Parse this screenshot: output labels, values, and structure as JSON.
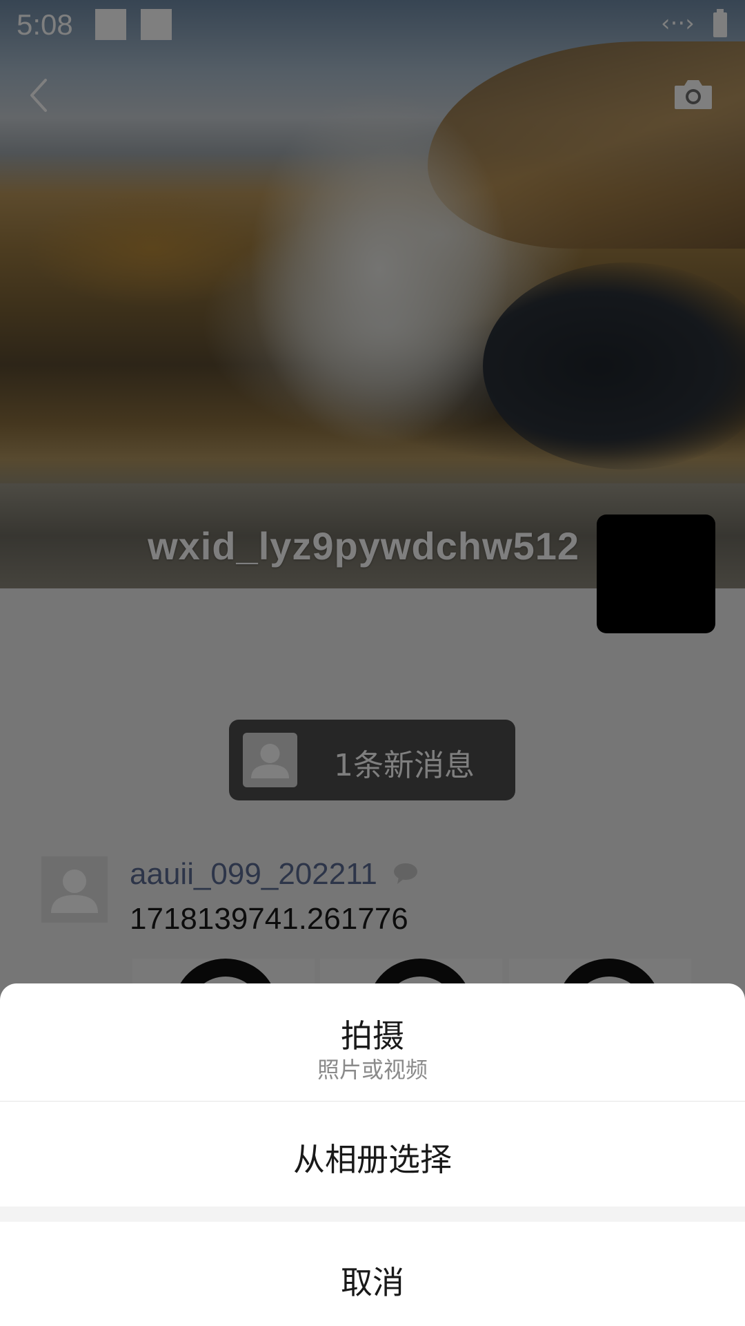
{
  "status_bar": {
    "time": "5:08"
  },
  "profile": {
    "username": "wxid_lyz9pywdchw512"
  },
  "notification": {
    "text": "1条新消息"
  },
  "post": {
    "author": "aauii_099_202211",
    "content": "1718139741.261776"
  },
  "action_sheet": {
    "capture_label": "拍摄",
    "capture_sub": "照片或视频",
    "album_label": "从相册选择",
    "cancel_label": "取消"
  },
  "icons": {
    "back": "chevron-left-icon",
    "camera": "camera-icon",
    "comment": "comment-bubble-icon"
  },
  "colors": {
    "author_link": "#5b6a92",
    "sheet_bg": "#ffffff",
    "overlay": "rgba(0,0,0,0.5)"
  }
}
